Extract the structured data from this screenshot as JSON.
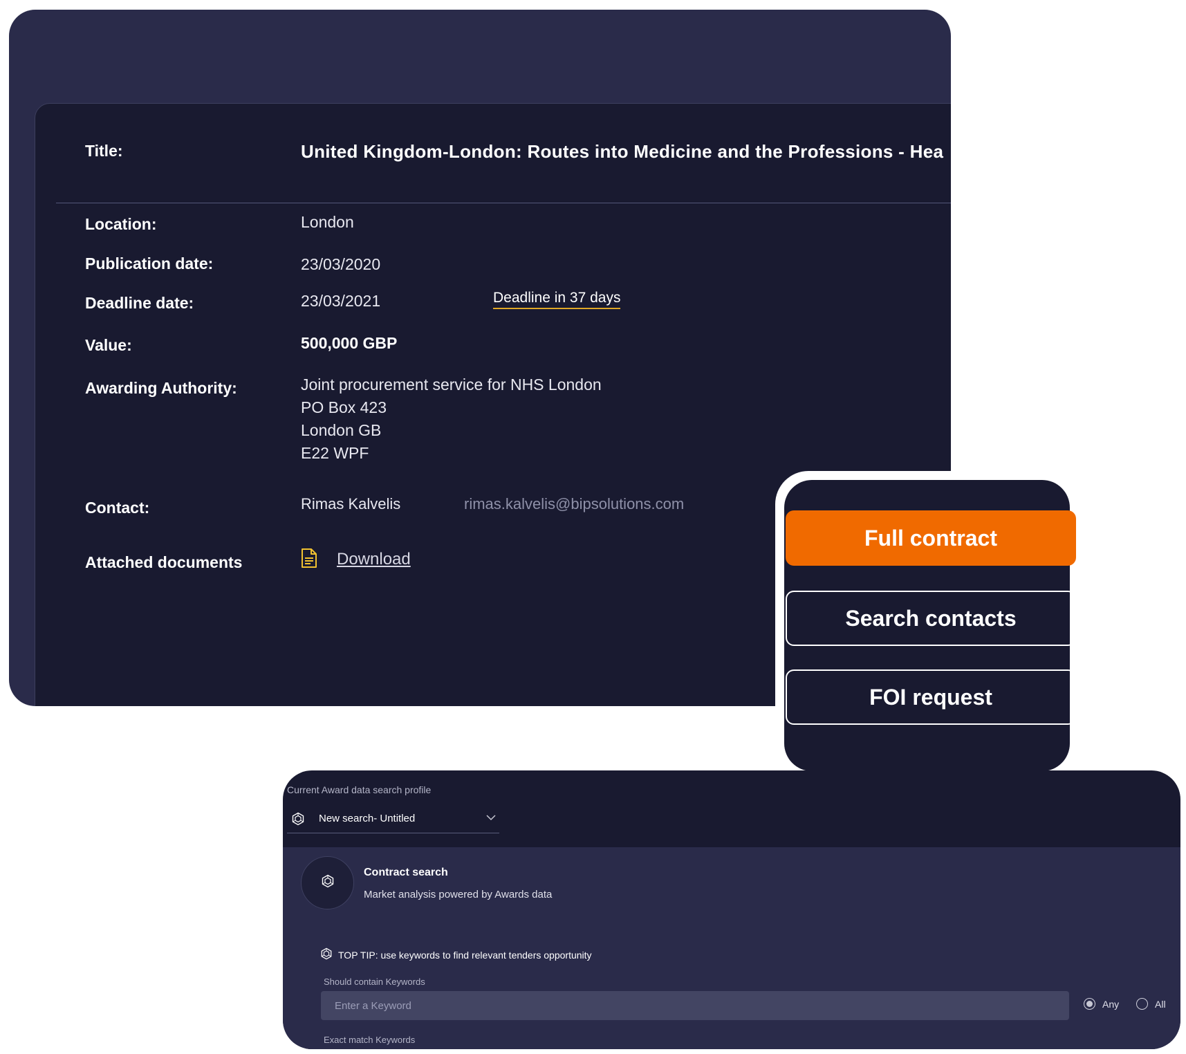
{
  "detail": {
    "title_label": "Title:",
    "title_value": "United Kingdom-London: Routes into Medicine and the Professions - Hea",
    "location_label": "Location:",
    "location_value": "London",
    "publication_label": "Publication date:",
    "publication_value": "23/03/2020",
    "deadline_label": "Deadline date:",
    "deadline_value": "23/03/2021",
    "deadline_badge": "Deadline in 37 days",
    "value_label": "Value:",
    "value_value": "500,000 GBP",
    "authority_label": "Awarding Authority:",
    "authority_lines": [
      "Joint procurement service for NHS London",
      "PO Box 423",
      "London GB",
      "E22 WPF"
    ],
    "contact_label": "Contact:",
    "contact_name": "Rimas Kalvelis",
    "contact_email": "rimas.kalvelis@bipsolutions.com",
    "attached_label": "Attached documents",
    "download_label": "Download"
  },
  "actions": {
    "full_contract": "Full contract",
    "search_contacts": "Search contacts",
    "foi_request": "FOI request"
  },
  "search": {
    "profile_label": "Current Award data search profile",
    "profile_value": "New search- Untitled",
    "contract_title": "Contract search",
    "contract_subtitle": "Market analysis powered by Awards data",
    "tip": "TOP TIP: use keywords to find relevant tenders opportunity",
    "should_contain_label": "Should contain Keywords",
    "keyword_placeholder": "Enter a Keyword",
    "radio_any": "Any",
    "radio_all": "All",
    "exact_match_label": "Exact match Keywords"
  },
  "colors": {
    "accent": "#f06a00",
    "underline": "#e0a826",
    "panel": "#191a30",
    "card": "#2a2b4a"
  }
}
